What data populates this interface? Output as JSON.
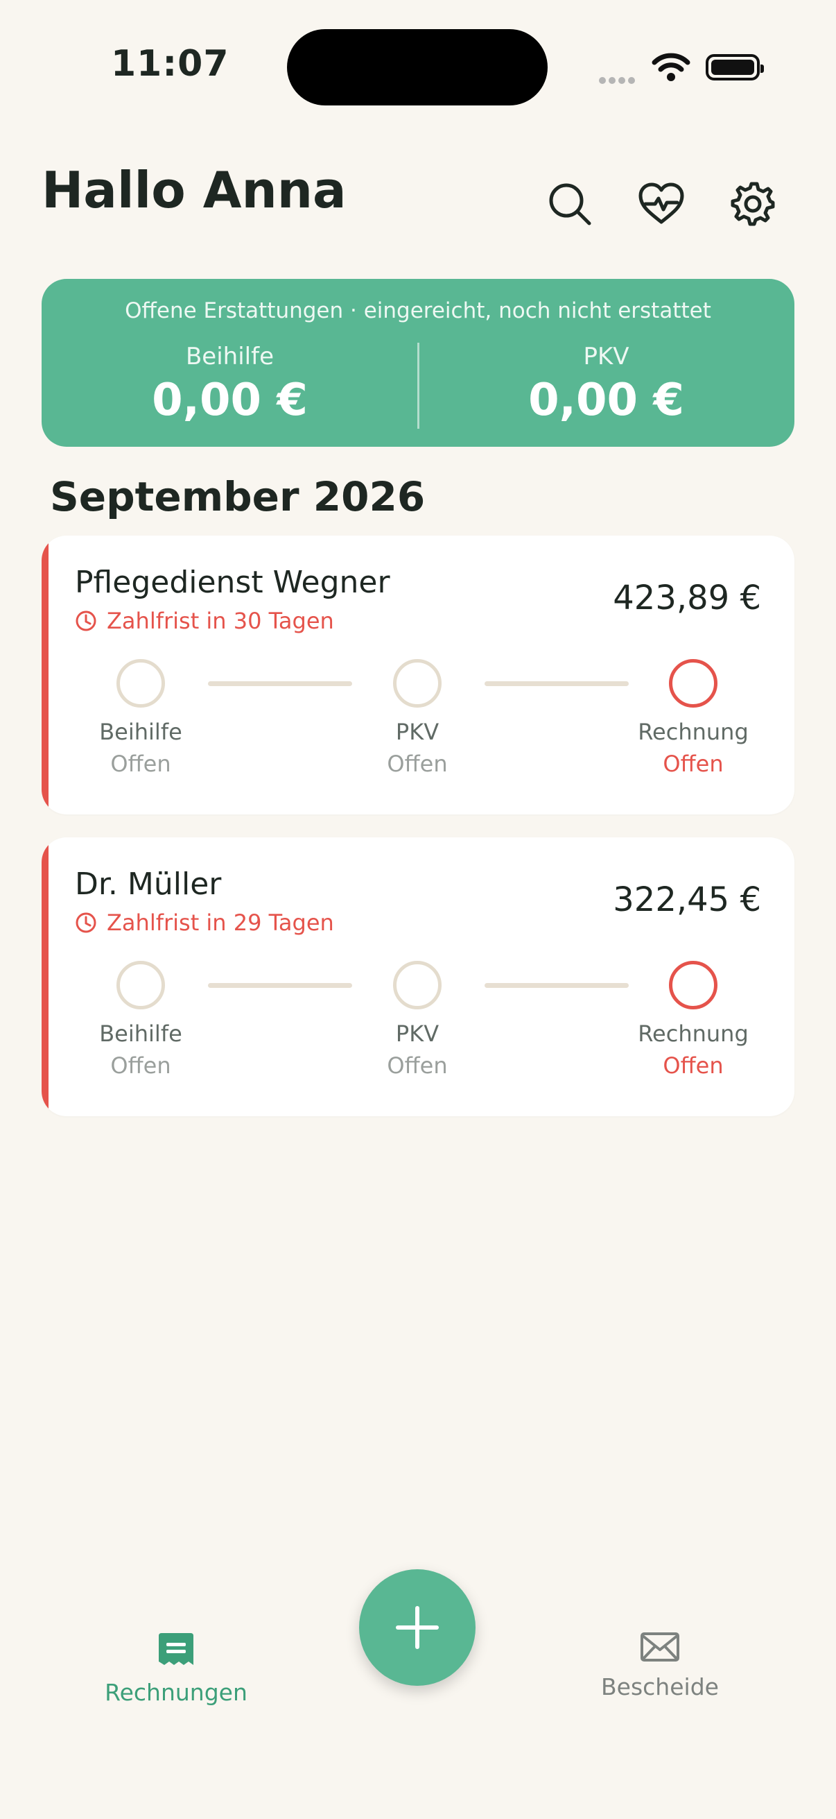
{
  "status_bar": {
    "time": "11:07"
  },
  "header": {
    "greeting": "Hallo Anna",
    "icons": [
      "search-icon",
      "heart-pulse-icon",
      "gear-icon"
    ]
  },
  "summary": {
    "title": "Offene Erstattungen · eingereicht, noch nicht erstattet",
    "beihilfe_label": "Beihilfe",
    "beihilfe_value": "0,00 €",
    "pkv_label": "PKV",
    "pkv_value": "0,00 €"
  },
  "month_heading": "September 2026",
  "invoices": [
    {
      "name": "Pflegedienst Wegner",
      "amount": "423,89 €",
      "deadline": "Zahlfrist in 30 Tagen",
      "steps": [
        {
          "label": "Beihilfe",
          "status": "Offen"
        },
        {
          "label": "PKV",
          "status": "Offen"
        },
        {
          "label": "Rechnung",
          "status": "Offen"
        }
      ]
    },
    {
      "name": "Dr. Müller",
      "amount": "322,45 €",
      "deadline": "Zahlfrist in 29 Tagen",
      "steps": [
        {
          "label": "Beihilfe",
          "status": "Offen"
        },
        {
          "label": "PKV",
          "status": "Offen"
        },
        {
          "label": "Rechnung",
          "status": "Offen"
        }
      ]
    }
  ],
  "nav": {
    "rechnungen_label": "Rechnungen",
    "bescheide_label": "Bescheide"
  },
  "colors": {
    "accent": "#59b793",
    "alert": "#e5534b",
    "background": "#f9f6f0"
  }
}
